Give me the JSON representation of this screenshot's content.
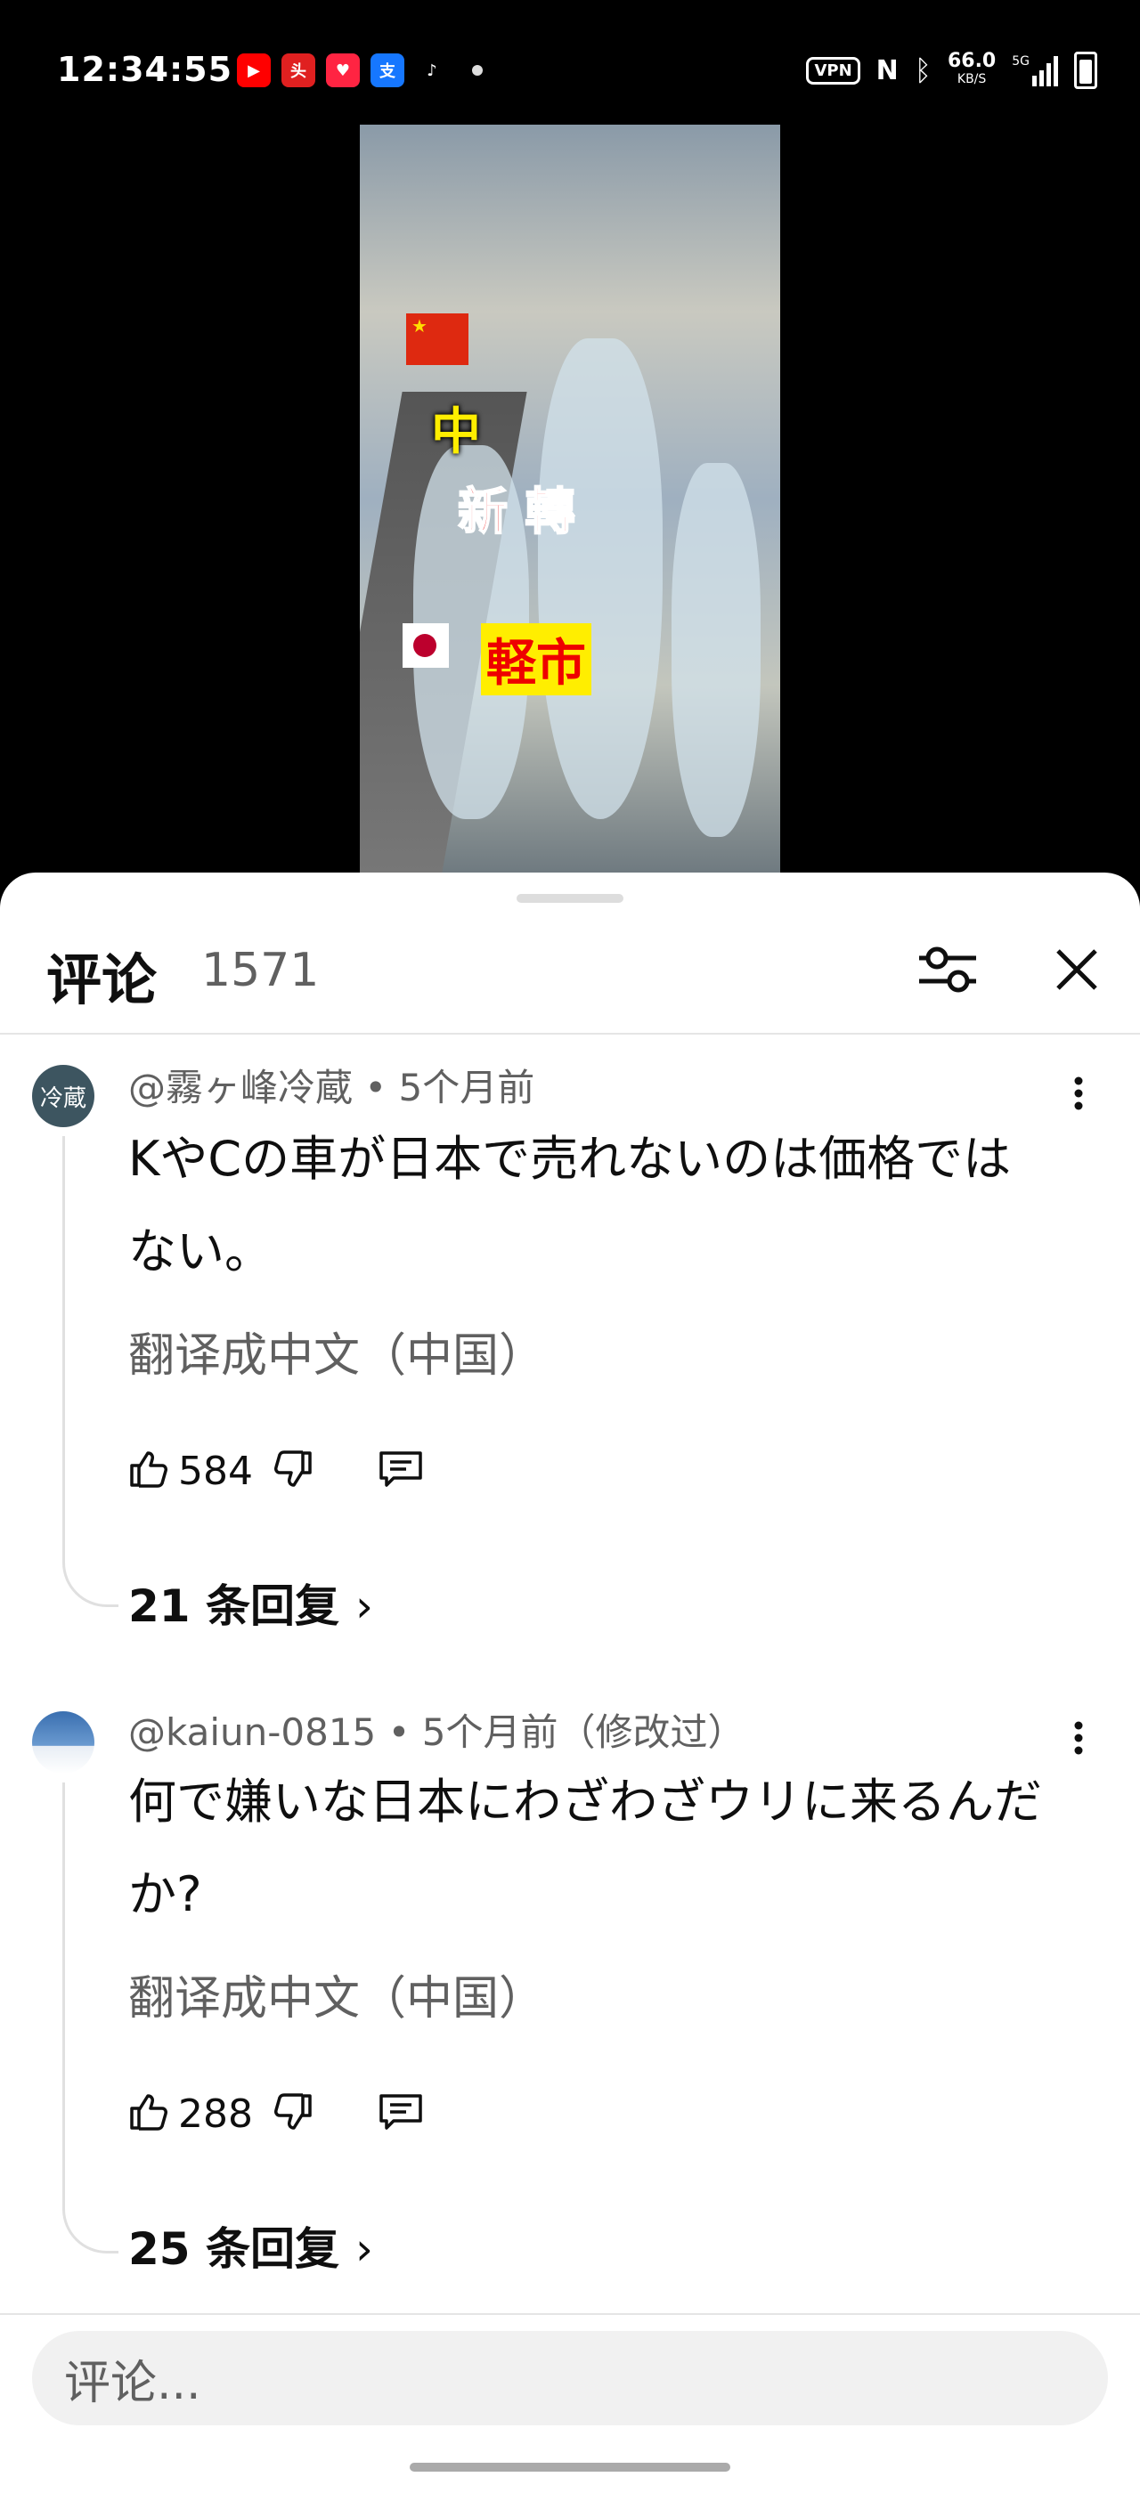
{
  "status": {
    "time": "12:34:55",
    "vpn": "VPN",
    "speed_value": "66.0",
    "speed_unit": "KB/S",
    "network": "5G"
  },
  "notification_icons": [
    "youtube-icon",
    "toutiao-icon",
    "xiaohongshu-icon",
    "alipay-icon",
    "tiktok-icon"
  ],
  "video": {
    "cap_line1": "中 ",
    "cap_line2": "新 轉",
    "cap_line3": "軽市"
  },
  "sheet": {
    "title": "评论",
    "count": "1571"
  },
  "comments": [
    {
      "avatar_text": "冷蔵",
      "meta": "@霧ヶ峰冷蔵 • 5个月前",
      "text": "KやCの車が日本で売れないのは価格ではない。",
      "translate": "翻译成中文（中国）",
      "likes": "584",
      "replies": "21 条回复"
    },
    {
      "avatar_text": "",
      "meta": "@kaiun-0815 • 5个月前（修改过）",
      "text": "何で嫌いな日本にわざわざウリに来るんだか?",
      "translate": "翻译成中文（中国）",
      "likes": "288",
      "replies": "25 条回复"
    }
  ],
  "input": {
    "placeholder": "评论..."
  },
  "colors": {
    "sheet_bg": "#ffffff",
    "muted": "#606060",
    "input_bg": "#f1f1f1"
  }
}
